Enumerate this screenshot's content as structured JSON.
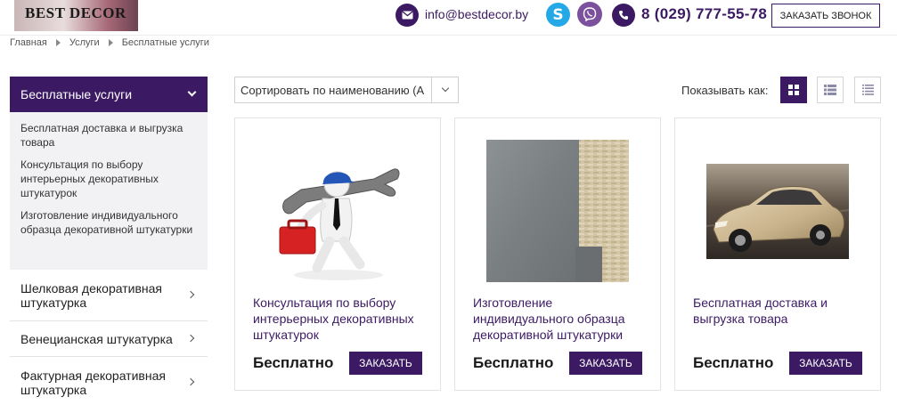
{
  "header": {
    "logo_text": "BEST DECOR",
    "email": "info@bestdecor.by",
    "phone": "8 (029) 777-55-78",
    "callback_label": "ЗАКАЗАТЬ ЗВОНОК",
    "icons": [
      "email-icon",
      "skype-icon",
      "viber-icon",
      "phone-icon"
    ],
    "skype_glyph": "S"
  },
  "breadcrumb": [
    "Главная",
    "Услуги",
    "Бесплатные услуги"
  ],
  "sidebar": {
    "active_section": "Бесплатные услуги",
    "sub_items": [
      "Бесплатная доставка и выгрузка товара",
      "Консультация по выбору интерьерных декоративных штукатурок",
      "Изготовление индивидуального образца декоративной штукатурки"
    ],
    "items": [
      "Шелковая декоративная штукатурка",
      "Венецианская штукатурка",
      "Фактурная декоративная штукатурка"
    ]
  },
  "toolbar": {
    "sort_value": "Сортировать по наименованию (А",
    "view_label": "Показывать как:",
    "views": [
      "grid",
      "list",
      "table"
    ],
    "active_view": "grid"
  },
  "products": [
    {
      "title": "Консультация по выбору интерьерных декоративных штукатурок",
      "price": "Бесплатно",
      "button": "ЗАКАЗАТЬ",
      "image": "worker-with-wrench"
    },
    {
      "title": "Изготовление индивидуального образца декоративной штукатурки",
      "price": "Бесплатно",
      "button": "ЗАКАЗАТЬ",
      "image": "plaster-sample"
    },
    {
      "title": "Бесплатная доставка и выгрузка товара",
      "price": "Бесплатно",
      "button": "ЗАКАЗАТЬ",
      "image": "car"
    }
  ],
  "colors": {
    "accent": "#3b1a63",
    "skype": "#24a9e6",
    "viber": "#7b519d"
  }
}
